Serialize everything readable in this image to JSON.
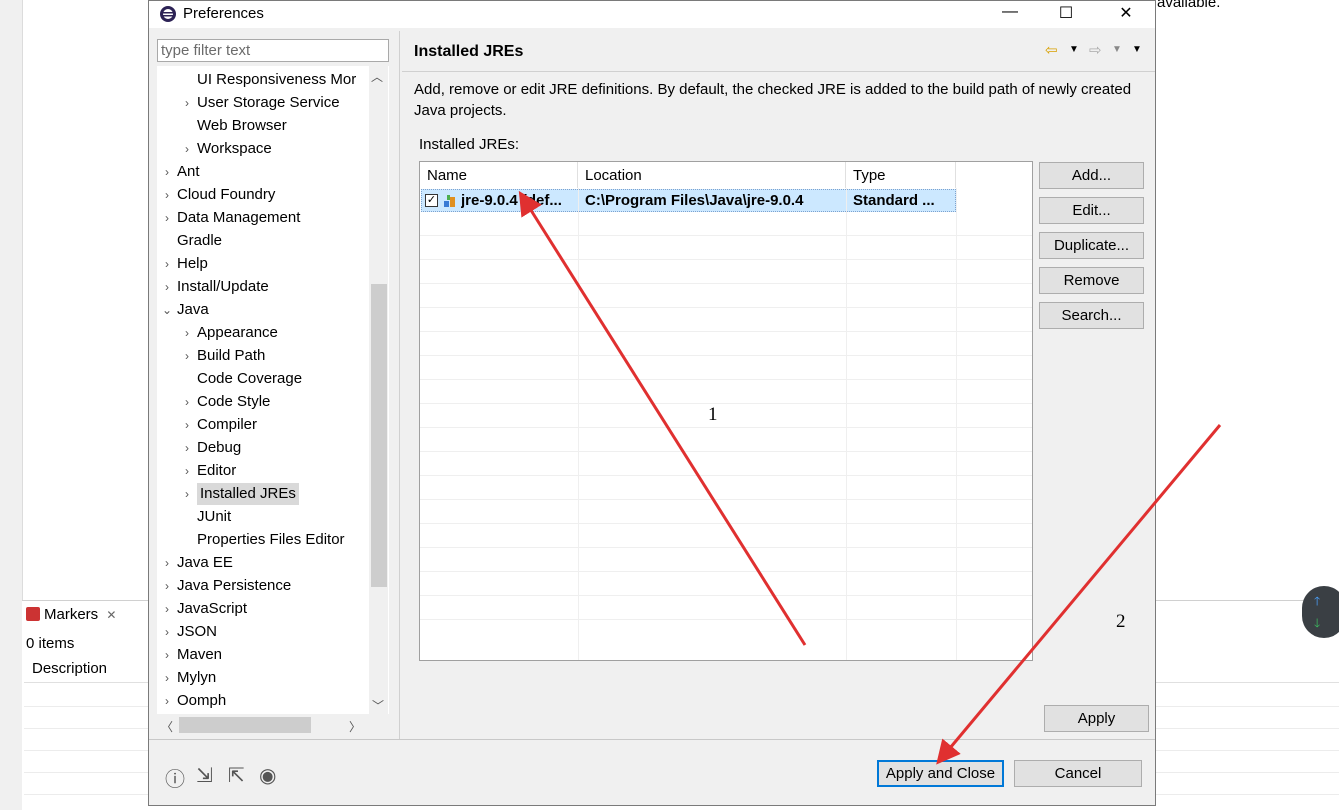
{
  "background": {
    "truncated_text": "available.",
    "markers_tab": "Markers",
    "items_count": "0 items",
    "description_header": "Description"
  },
  "dialog": {
    "title": "Preferences",
    "filter_placeholder": "type filter text",
    "tree": [
      {
        "label": "UI Responsiveness Mor",
        "level": 2,
        "expandable": false
      },
      {
        "label": "User Storage Service",
        "level": 2,
        "expandable": true
      },
      {
        "label": "Web Browser",
        "level": 2,
        "expandable": false
      },
      {
        "label": "Workspace",
        "level": 2,
        "expandable": true
      },
      {
        "label": "Ant",
        "level": 1,
        "expandable": true
      },
      {
        "label": "Cloud Foundry",
        "level": 1,
        "expandable": true
      },
      {
        "label": "Data Management",
        "level": 1,
        "expandable": true
      },
      {
        "label": "Gradle",
        "level": 1,
        "expandable": false
      },
      {
        "label": "Help",
        "level": 1,
        "expandable": true
      },
      {
        "label": "Install/Update",
        "level": 1,
        "expandable": true
      },
      {
        "label": "Java",
        "level": 1,
        "expandable": true,
        "expanded": true
      },
      {
        "label": "Appearance",
        "level": 2,
        "expandable": true
      },
      {
        "label": "Build Path",
        "level": 2,
        "expandable": true
      },
      {
        "label": "Code Coverage",
        "level": 2,
        "expandable": false
      },
      {
        "label": "Code Style",
        "level": 2,
        "expandable": true
      },
      {
        "label": "Compiler",
        "level": 2,
        "expandable": true
      },
      {
        "label": "Debug",
        "level": 2,
        "expandable": true
      },
      {
        "label": "Editor",
        "level": 2,
        "expandable": true
      },
      {
        "label": "Installed JREs",
        "level": 2,
        "expandable": true,
        "selected": true
      },
      {
        "label": "JUnit",
        "level": 2,
        "expandable": false
      },
      {
        "label": "Properties Files Editor",
        "level": 2,
        "expandable": false
      },
      {
        "label": "Java EE",
        "level": 1,
        "expandable": true
      },
      {
        "label": "Java Persistence",
        "level": 1,
        "expandable": true
      },
      {
        "label": "JavaScript",
        "level": 1,
        "expandable": true
      },
      {
        "label": "JSON",
        "level": 1,
        "expandable": true
      },
      {
        "label": "Maven",
        "level": 1,
        "expandable": true
      },
      {
        "label": "Mylyn",
        "level": 1,
        "expandable": true
      },
      {
        "label": "Oomph",
        "level": 1,
        "expandable": true
      }
    ],
    "page": {
      "title": "Installed JREs",
      "description": "Add, remove or edit JRE definitions. By default, the checked JRE is added to the build path of newly created Java projects.",
      "list_label": "Installed JREs:",
      "columns": [
        "Name",
        "Location",
        "Type"
      ],
      "rows": [
        {
          "name": "jre-9.0.4 (def...",
          "location": "C:\\Program Files\\Java\\jre-9.0.4",
          "type": "Standard ...",
          "checked": true
        }
      ],
      "side_buttons": [
        "Add...",
        "Edit...",
        "Duplicate...",
        "Remove",
        "Search..."
      ],
      "apply": "Apply"
    },
    "footer": {
      "apply_and_close": "Apply and Close",
      "cancel": "Cancel"
    }
  },
  "annotations": {
    "label1": "1",
    "label2": "2",
    "color": "#e03030"
  }
}
